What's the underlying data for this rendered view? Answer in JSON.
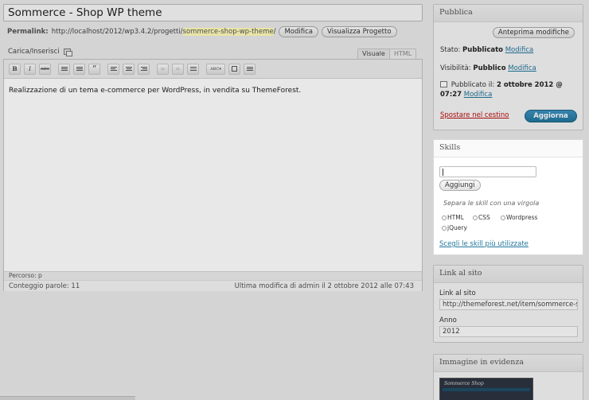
{
  "post": {
    "title": "Sommerce - Shop WP theme",
    "permalink_label": "Permalink:",
    "permalink_base": "http://localhost/2012/wp3.4.2/progetti/",
    "permalink_slug": "sommerce-shop-wp-theme",
    "permalink_tail": "/",
    "edit_button": "Modifica",
    "view_button": "Visualizza Progetto"
  },
  "editor": {
    "media_label": "Carica/Inserisci",
    "tab_visual": "Visuale",
    "tab_html": "HTML",
    "content": "Realizzazione di un tema e-commerce per WordPress, in vendita su ThemeForest.",
    "path_label": "Percorso:",
    "path_value": "p",
    "word_count": "Conteggio parole: 11",
    "last_modified": "Ultima modifica di admin il 2 ottobre 2012 alle 07:43",
    "toolbar": {
      "bold": "B",
      "italic": "I",
      "strike": "ABC",
      "quote": "“",
      "spellcheck": "ABC"
    }
  },
  "publish": {
    "title": "Pubblica",
    "preview_button": "Anteprima modifiche",
    "status_label": "Stato:",
    "status_value": "Pubblicato",
    "status_edit": "Modifica",
    "visibility_label": "Visibilità:",
    "visibility_value": "Pubblico",
    "visibility_edit": "Modifica",
    "published_label": "Pubblicato il:",
    "published_date": "2 ottobre 2012 @",
    "published_time": "07:27",
    "published_edit": "Modifica",
    "trash_link": "Spostare nel cestino",
    "update_button": "Aggiorna"
  },
  "skills": {
    "title": "Skills",
    "add_button": "Aggiungi",
    "hint": "Separa le skill con una virgola",
    "options": [
      "HTML",
      "CSS",
      "Wordpress",
      "jQuery"
    ],
    "popular_link": "Scegli le skill più utilizzate"
  },
  "site_link": {
    "title": "Link al sito",
    "url_label": "Link al sito",
    "url_value": "http://themeforest.net/item/sommerce-s",
    "year_label": "Anno",
    "year_value": "2012"
  },
  "featured_image": {
    "title": "Immagine in evidenza",
    "thumb_title": "Sommerce Shop"
  },
  "colors": {
    "link": "#21759b",
    "update_button": "#21759b",
    "trash": "#bc0b0b"
  }
}
